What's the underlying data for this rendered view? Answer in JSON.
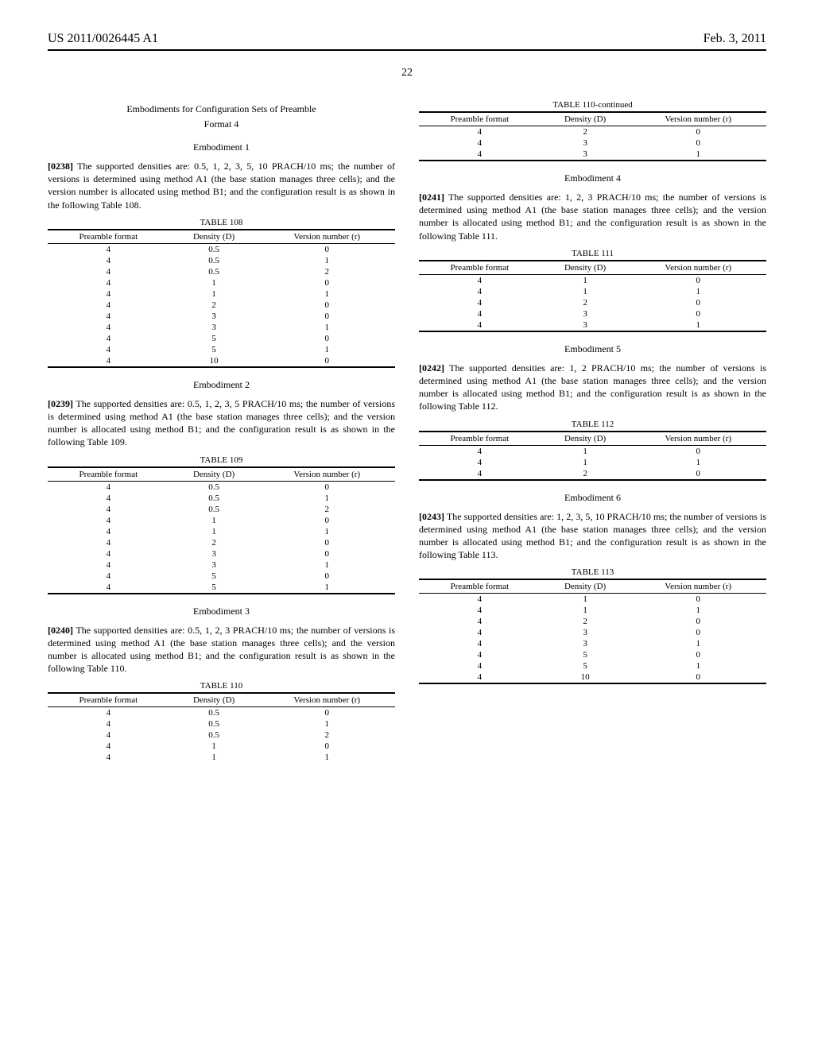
{
  "header": {
    "pub_number": "US 2011/0026445 A1",
    "date": "Feb. 3, 2011",
    "page_number": "22"
  },
  "left": {
    "section_title_line1": "Embodiments for Configuration Sets of Preamble",
    "section_title_line2": "Format 4",
    "emb1_title": "Embodiment 1",
    "p0238_num": "[0238]",
    "p0238_text": " The supported densities are: 0.5, 1, 2, 3, 5, 10 PRACH/10 ms; the number of versions is determined using method A1 (the base station manages three cells); and the version number is allocated using method B1; and the configuration result is as shown in the following Table 108.",
    "table108_caption": "TABLE 108",
    "cols": {
      "c1": "Preamble format",
      "c2": "Density (D)",
      "c3": "Version number (r)"
    },
    "table108_rows": [
      [
        "4",
        "0.5",
        "0"
      ],
      [
        "4",
        "0.5",
        "1"
      ],
      [
        "4",
        "0.5",
        "2"
      ],
      [
        "4",
        "1",
        "0"
      ],
      [
        "4",
        "1",
        "1"
      ],
      [
        "4",
        "2",
        "0"
      ],
      [
        "4",
        "3",
        "0"
      ],
      [
        "4",
        "3",
        "1"
      ],
      [
        "4",
        "5",
        "0"
      ],
      [
        "4",
        "5",
        "1"
      ],
      [
        "4",
        "10",
        "0"
      ]
    ],
    "emb2_title": "Embodiment 2",
    "p0239_num": "[0239]",
    "p0239_text": " The supported densities are: 0.5, 1, 2, 3, 5 PRACH/10 ms; the number of versions is determined using method A1 (the base station manages three cells); and the version number is allocated using method B1; and the configuration result is as shown in the following Table 109.",
    "table109_caption": "TABLE 109",
    "table109_rows": [
      [
        "4",
        "0.5",
        "0"
      ],
      [
        "4",
        "0.5",
        "1"
      ],
      [
        "4",
        "0.5",
        "2"
      ],
      [
        "4",
        "1",
        "0"
      ],
      [
        "4",
        "1",
        "1"
      ],
      [
        "4",
        "2",
        "0"
      ],
      [
        "4",
        "3",
        "0"
      ],
      [
        "4",
        "3",
        "1"
      ],
      [
        "4",
        "5",
        "0"
      ],
      [
        "4",
        "5",
        "1"
      ]
    ],
    "emb3_title": "Embodiment 3",
    "p0240_num": "[0240]",
    "p0240_text": " The supported densities are: 0.5, 1, 2, 3 PRACH/10 ms; the number of versions is determined using method A1 (the base station manages three cells); and the version number is allocated using method B1; and the configuration result is as shown in the following Table 110.",
    "table110_caption": "TABLE 110",
    "table110_rows": [
      [
        "4",
        "0.5",
        "0"
      ],
      [
        "4",
        "0.5",
        "1"
      ],
      [
        "4",
        "0.5",
        "2"
      ],
      [
        "4",
        "1",
        "0"
      ],
      [
        "4",
        "1",
        "1"
      ]
    ]
  },
  "right": {
    "table110c_caption": "TABLE 110-continued",
    "table110c_rows": [
      [
        "4",
        "2",
        "0"
      ],
      [
        "4",
        "3",
        "0"
      ],
      [
        "4",
        "3",
        "1"
      ]
    ],
    "emb4_title": "Embodiment 4",
    "p0241_num": "[0241]",
    "p0241_text": " The supported densities are: 1, 2, 3 PRACH/10 ms; the number of versions is determined using method A1 (the base station manages three cells); and the version number is allocated using method B1; and the configuration result is as shown in the following Table 111.",
    "table111_caption": "TABLE 111",
    "table111_rows": [
      [
        "4",
        "1",
        "0"
      ],
      [
        "4",
        "1",
        "1"
      ],
      [
        "4",
        "2",
        "0"
      ],
      [
        "4",
        "3",
        "0"
      ],
      [
        "4",
        "3",
        "1"
      ]
    ],
    "emb5_title": "Embodiment 5",
    "p0242_num": "[0242]",
    "p0242_text": " The supported densities are: 1, 2 PRACH/10 ms; the number of versions is determined using method A1 (the base station manages three cells); and the version number is allocated using method B1; and the configuration result is as shown in the following Table 112.",
    "table112_caption": "TABLE 112",
    "table112_rows": [
      [
        "4",
        "1",
        "0"
      ],
      [
        "4",
        "1",
        "1"
      ],
      [
        "4",
        "2",
        "0"
      ]
    ],
    "emb6_title": "Embodiment 6",
    "p0243_num": "[0243]",
    "p0243_text": " The supported densities are: 1, 2, 3, 5, 10 PRACH/10 ms; the number of versions is determined using method A1 (the base station manages three cells); and the version number is allocated using method B1; and the configuration result is as shown in the following Table 113.",
    "table113_caption": "TABLE 113",
    "table113_rows": [
      [
        "4",
        "1",
        "0"
      ],
      [
        "4",
        "1",
        "1"
      ],
      [
        "4",
        "2",
        "0"
      ],
      [
        "4",
        "3",
        "0"
      ],
      [
        "4",
        "3",
        "1"
      ],
      [
        "4",
        "5",
        "0"
      ],
      [
        "4",
        "5",
        "1"
      ],
      [
        "4",
        "10",
        "0"
      ]
    ]
  }
}
